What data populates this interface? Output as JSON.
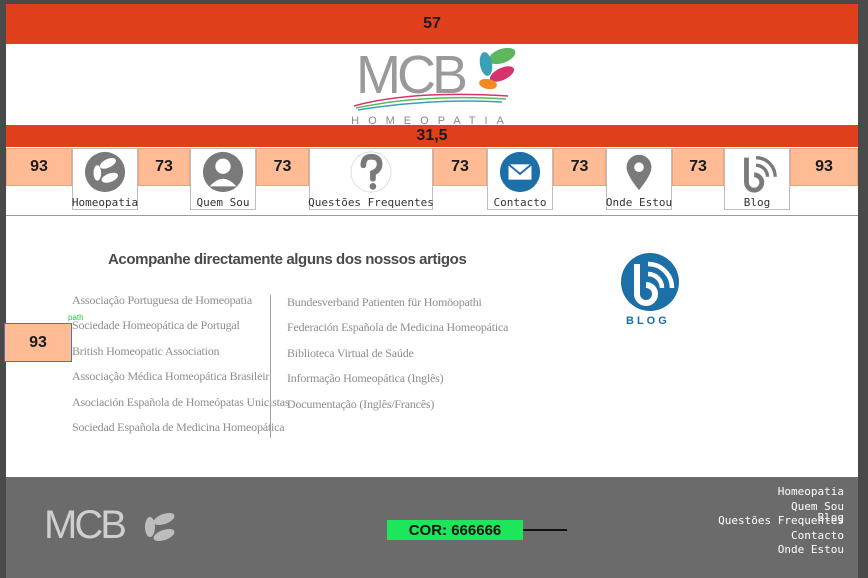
{
  "bars": {
    "top_label": "57",
    "mid_label": "31,5"
  },
  "logo": {
    "text": "MCB",
    "subtitle": "HOMEOPATIA"
  },
  "nav": {
    "spacer_outer": "93",
    "spacer_inner": "73",
    "items": [
      {
        "label": "Homeopatia",
        "icon": "leaves-icon"
      },
      {
        "label": "Quem Sou",
        "icon": "person-icon"
      },
      {
        "label": "Questões Frequentes",
        "icon": "question-icon"
      },
      {
        "label": "Contacto",
        "icon": "envelope-icon"
      },
      {
        "label": "Onde Estou",
        "icon": "map-pin-icon"
      },
      {
        "label": "Blog",
        "icon": "blog-icon"
      }
    ]
  },
  "content": {
    "heading": "Acompanhe directamente alguns dos nossos artigos",
    "left_links": [
      "Associação Portuguesa de Homeopatia",
      "Sociedade Homeopática de Portugal",
      "British Homeopatic Association",
      "Associação Médica Homeopática Brasileir",
      "Asociación Española de Homeópatas Unicistas",
      "Sociedad Española de Medicina Homeopática"
    ],
    "right_links": [
      "Bundesverband Patienten für Homöopathi",
      "Federación Española de Medicina Homeopática",
      "Biblioteca Virtual de Saúde",
      "Informação Homeopática (Inglês)",
      "Documentação (Inglês/Francês)"
    ],
    "floating_label": "93",
    "path_tag": "path",
    "blog_word": "BLOG"
  },
  "footer": {
    "logo_text": "MCB",
    "cor_label": "COR: 666666",
    "nav": [
      "Homeopatia",
      "Quem Sou",
      "Questões Frequentes",
      "Contacto",
      "Onde Estou"
    ],
    "blog": "Blog"
  },
  "colors": {
    "orange": "#df3f1a",
    "peach": "#ffbb93",
    "footer_bg": "#6b6b6b",
    "cor_green": "#1de65a",
    "blog_blue": "#1d6fa8"
  }
}
